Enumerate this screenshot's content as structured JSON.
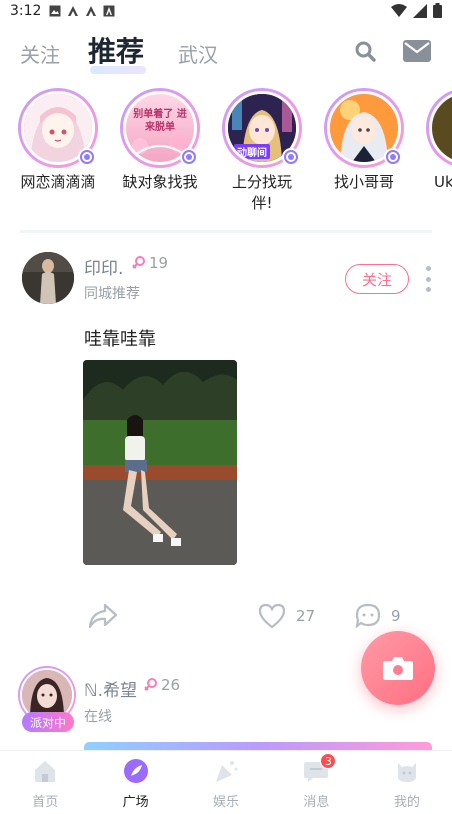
{
  "status_bar": {
    "time": "3:12"
  },
  "top_nav": {
    "tabs": [
      {
        "label": "关注",
        "active": false
      },
      {
        "label": "推荐",
        "active": true
      },
      {
        "label": "武汉",
        "active": false
      }
    ],
    "search_icon": "search-icon",
    "mail_icon": "mail-icon"
  },
  "stories": [
    {
      "label": "网恋滴滴滴",
      "avatar": "anime-girl-pink"
    },
    {
      "label": "缺对象找我",
      "avatar": "text-card-pink",
      "avatar_text": "别单着了 进来脱单"
    },
    {
      "label": "上分找玩伴!",
      "avatar": "anime-girl-purple",
      "avatar_text": "动聊间"
    },
    {
      "label": "找小哥哥",
      "avatar": "anime-boy-orange"
    },
    {
      "label": "Uk",
      "avatar": "partial"
    }
  ],
  "post": {
    "name": "印印.",
    "age": "19",
    "subtitle": "同城推荐",
    "follow_label": "关注",
    "text": "哇靠哇靠",
    "likes": "27",
    "comments": "9"
  },
  "post2": {
    "name": "ℕ.希望",
    "age": "26",
    "status": "在线",
    "tag": "派对中"
  },
  "bottom_nav": {
    "items": [
      {
        "label": "首页",
        "icon": "home-icon",
        "active": false
      },
      {
        "label": "广场",
        "icon": "feather-icon",
        "active": true
      },
      {
        "label": "娱乐",
        "icon": "party-icon",
        "active": false
      },
      {
        "label": "消息",
        "icon": "message-icon",
        "active": false,
        "badge": "3"
      },
      {
        "label": "我的",
        "icon": "profile-icon",
        "active": false
      }
    ]
  },
  "colors": {
    "accent_pink": "#ff6f8f",
    "brand_purple": "#8f7bff"
  }
}
